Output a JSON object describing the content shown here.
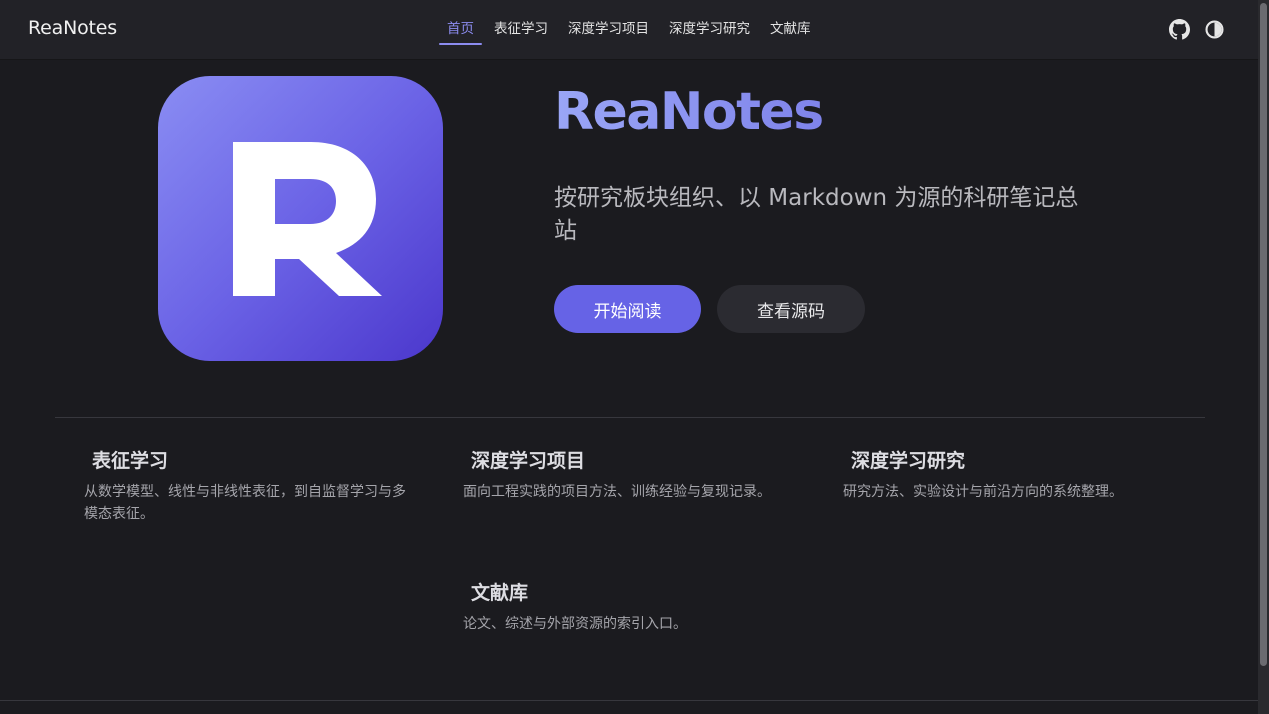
{
  "navbar": {
    "brand": "ReaNotes",
    "links": [
      {
        "label": "首页",
        "active": true
      },
      {
        "label": "表征学习",
        "active": false
      },
      {
        "label": "深度学习项目",
        "active": false
      },
      {
        "label": "深度学习研究",
        "active": false
      },
      {
        "label": "文献库",
        "active": false
      }
    ],
    "icons": [
      "github-icon",
      "theme-toggle-icon"
    ]
  },
  "hero": {
    "logo_letter": "R",
    "title": "ReaNotes",
    "tagline": "按研究板块组织、以 Markdown 为源的科研笔记总站",
    "primary_button": "开始阅读",
    "secondary_button": "查看源码"
  },
  "features": [
    {
      "title": "表征学习",
      "desc": "从数学模型、线性与非线性表征，到自监督学习与多模态表征。"
    },
    {
      "title": "深度学习项目",
      "desc": "面向工程实践的项目方法、训练经验与复现记录。"
    },
    {
      "title": "深度学习研究",
      "desc": "研究方法、实验设计与前沿方向的系统整理。"
    },
    {
      "title": "文献库",
      "desc": "论文、综述与外部资源的索引入口。"
    }
  ],
  "colors": {
    "background": "#1b1b1f",
    "navbar": "#222227",
    "accent": "#6663e6",
    "accent_text": "#8c8cf0"
  }
}
